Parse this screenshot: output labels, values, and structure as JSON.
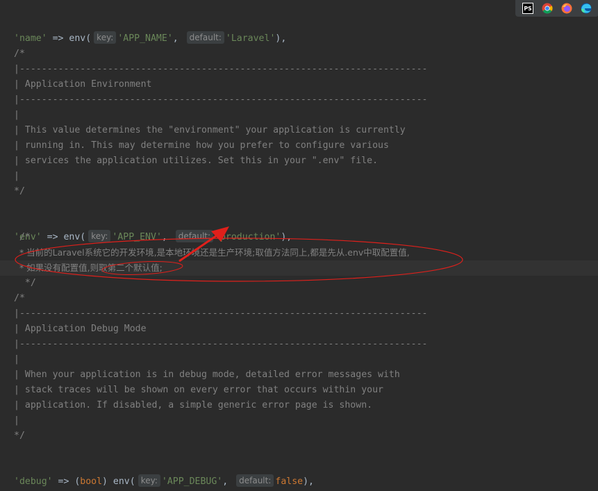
{
  "browser_icons": {
    "phpstorm": "PS",
    "chrome": "chrome-icon",
    "firefox": "firefox-icon",
    "edge": "edge-icon"
  },
  "hints": {
    "key": "key:",
    "default": "default:"
  },
  "code": {
    "name_line": {
      "key_str": "'name'",
      "arrow": " => env(",
      "arg1": "'APP_NAME'",
      "comma": ", ",
      "arg2": "'Laravel'",
      "close": "),"
    },
    "block1": {
      "open": "/*",
      "rule": "|--------------------------------------------------------------------------",
      "title": "| Application Environment",
      "bar": "|",
      "desc1": "| This value determines the \"environment\" your application is currently",
      "desc2": "| running in. This may determine how you prefer to configure various",
      "desc3": "| services the application utilizes. Set this in your \".env\" file.",
      "close": "*/"
    },
    "env_line": {
      "key_str": "'env'",
      "arrow": " => env(",
      "arg1": "'APP_ENV'",
      "comma": ", ",
      "arg2": "'production'",
      "close": "),"
    },
    "cn_comment": {
      "open": " /*",
      "line1": "  * 当前的Laravel系统它的开发环境,是本地环境还是生产环境;取值方法同上,都是先从.env中取配置值,",
      "line2": "  * 如果没有配置值,则取第二个默认值;",
      "close": "  */"
    },
    "block2": {
      "open": "/*",
      "rule": "|--------------------------------------------------------------------------",
      "title": "| Application Debug Mode",
      "bar": "|",
      "desc1": "| When your application is in debug mode, detailed error messages with",
      "desc2": "| stack traces will be shown on every error that occurs within your",
      "desc3": "| application. If disabled, a simple generic error page is shown.",
      "close": "*/"
    },
    "debug_line": {
      "key_str": "'debug'",
      "arrow": " => (",
      "cast": "bool",
      "cast_close": ") env(",
      "arg1": "'APP_DEBUG'",
      "comma": ", ",
      "arg2": "false",
      "close": "),"
    }
  },
  "colors": {
    "background": "#2b2b2b",
    "string": "#6a8759",
    "keyword": "#cc7832",
    "comment": "#808080",
    "text": "#a9b7c6",
    "annotation": "#e0201b"
  }
}
